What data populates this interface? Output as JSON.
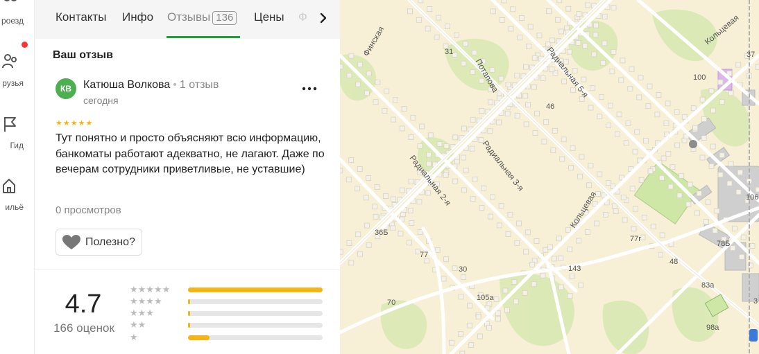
{
  "rail": {
    "items": [
      {
        "label": "роезд",
        "icon": "route-icon"
      },
      {
        "label": "рузья",
        "icon": "friends-icon"
      },
      {
        "label": "Гид",
        "icon": "flag-icon"
      },
      {
        "label": "ильё",
        "icon": "house-icon"
      }
    ]
  },
  "tabs": {
    "contacts": "Контакты",
    "info": "Инфо",
    "reviews": "Отзывы",
    "reviews_count": "136",
    "prices": "Цены",
    "faded": "Ф"
  },
  "review": {
    "section_title": "Ваш отзыв",
    "avatar_initials": "КВ",
    "author": "Катюша Волкова",
    "author_reviews": "1 отзыв",
    "date": "сегодня",
    "rating": 5,
    "stars": "★★★★★",
    "text": "Тут понятно и просто объясняют всю информацию, банкоматы работают адекватно, не лагают. Даже по вечерам сотрудники приветливые, не уставшие)",
    "views": "0 просмотров",
    "useful_label": "Полезно?"
  },
  "rating_summary": {
    "average": "4.7",
    "count_label": "166 оценок",
    "distribution": [
      {
        "stars": "★★★★★",
        "fraction": 1.0
      },
      {
        "stars": "★★★★",
        "fraction": 0.015
      },
      {
        "stars": "★★★",
        "fraction": 0.015
      },
      {
        "stars": "★★",
        "fraction": 0.015
      },
      {
        "stars": "★",
        "fraction": 0.16
      }
    ]
  },
  "map": {
    "streets": [
      "Финская",
      "Потапова",
      "Радиальная 5-я",
      "Радиальная 3-я",
      "Радиальная 2-я",
      "Кольцевая",
      "Кольцевая"
    ],
    "house_numbers": [
      "31",
      "46",
      "100",
      "37",
      "106",
      "36Б",
      "77",
      "30",
      "77г",
      "78Б",
      "48",
      "143",
      "83а",
      "70",
      "105а",
      "98а",
      "3"
    ]
  },
  "colors": {
    "accent_green": "#21a038",
    "star_gold": "#f5b514",
    "map_background": "#f7f0d6"
  }
}
